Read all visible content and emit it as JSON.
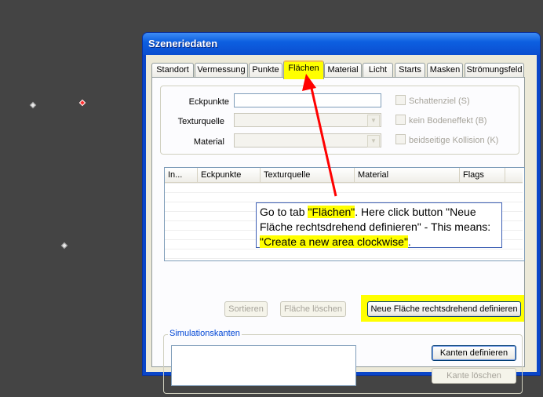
{
  "window": {
    "title": "Szeneriedaten"
  },
  "tabs": [
    {
      "label": "Standort"
    },
    {
      "label": "Vermessung"
    },
    {
      "label": "Punkte"
    },
    {
      "label": "Flächen"
    },
    {
      "label": "Material"
    },
    {
      "label": "Licht"
    },
    {
      "label": "Starts"
    },
    {
      "label": "Masken"
    },
    {
      "label": "Strömungsfeld"
    }
  ],
  "form": {
    "eckpunkte_label": "Eckpunkte",
    "eckpunkte_value": "",
    "texturquelle_label": "Texturquelle",
    "material_label": "Material"
  },
  "checkboxes": [
    {
      "label": "Schattenziel (S)"
    },
    {
      "label": "kein Bodeneffekt (B)"
    },
    {
      "label": "beidseitige Kollision (K)"
    }
  ],
  "table": {
    "columns": [
      "In...",
      "Eckpunkte",
      "Texturquelle",
      "Material",
      "Flags"
    ]
  },
  "buttons": {
    "sortieren": "Sortieren",
    "flaeche_loeschen": "Fläche löschen",
    "neue_flaeche": "Neue Fläche rechtsdrehend definieren",
    "kanten_definieren": "Kanten definieren",
    "kante_loeschen": "Kante löschen"
  },
  "simulationskanten": {
    "legend": "Simulationskanten"
  },
  "callout": {
    "part1": "Go to tab ",
    "tab_name": "\"Flächen\"",
    "part2": ". Here click button \"Neue Fläche rechtsdrehend definieren\" - This means: ",
    "meaning": "\"Create a new area clockwise\"",
    "part3": "."
  },
  "colors": {
    "highlight": "#ffff00",
    "arrow": "#ff0000",
    "titlebar": "#0a4ed0"
  }
}
